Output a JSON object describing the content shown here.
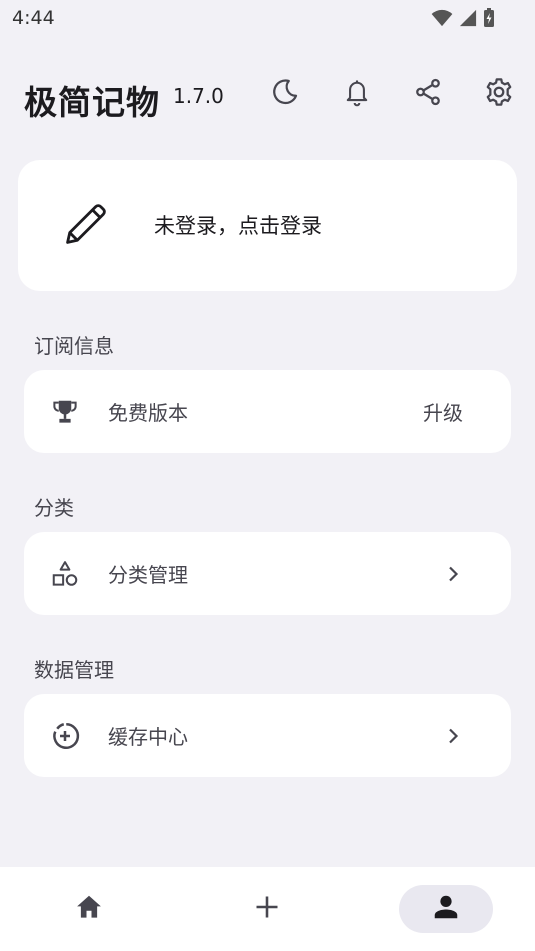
{
  "status_bar": {
    "time": "4:44",
    "icons": [
      "wifi-icon",
      "cell-signal-icon",
      "battery-charging-icon"
    ]
  },
  "header": {
    "title": "极简记物",
    "version": "1.7.0",
    "actions": [
      "moon-icon",
      "bell-icon",
      "share-icon",
      "gear-icon"
    ]
  },
  "login": {
    "text": "未登录，点击登录",
    "icon": "pencil-icon"
  },
  "sections": {
    "subscription": {
      "title": "订阅信息",
      "row_label": "免费版本",
      "row_action": "升级",
      "icon": "trophy-icon"
    },
    "category": {
      "title": "分类",
      "row_label": "分类管理",
      "icon": "shapes-icon"
    },
    "data": {
      "title": "数据管理",
      "row_label": "缓存中心",
      "icon": "data-usage-icon"
    }
  },
  "bottom_nav": {
    "items": [
      "home-icon",
      "add-icon",
      "person-icon"
    ],
    "active_index": 2
  },
  "colors": {
    "background": "#f2f1f6",
    "card": "#ffffff",
    "active_pill": "#e9e8f0",
    "text_primary": "#1c1b1f",
    "text_secondary": "#47464f"
  }
}
